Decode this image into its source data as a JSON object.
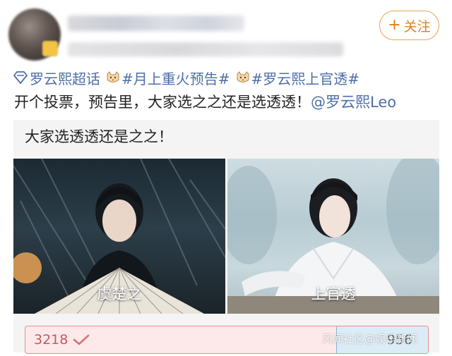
{
  "header": {
    "follow_label": "关注",
    "follow_plus": "+"
  },
  "post": {
    "tags": [
      {
        "text": "罗云熙超话",
        "icon": "super-topic-diamond-icon"
      },
      {
        "text": "#月上重火预告#",
        "icon": "cat-emoji-icon"
      },
      {
        "text": "#罗云熙上官透#",
        "icon": "cat-emoji-icon"
      }
    ],
    "body_text": "开个投票，预告里，大家选之之还是选透透！",
    "mention": "@罗云熙Leo"
  },
  "poll": {
    "title": "大家选透透还是之之！",
    "options": [
      {
        "label": "虞楚之",
        "votes": "3218",
        "selected": true
      },
      {
        "label": "上官透",
        "votes": "956",
        "selected": false
      }
    ]
  },
  "watermark": "风闻社区@娱乐新闻",
  "colors": {
    "link_blue": "#4e6ea8",
    "follow_orange": "#e07f1f",
    "vote_left_red": "#c9585f",
    "vote_right_blue": "#87b3d6"
  }
}
